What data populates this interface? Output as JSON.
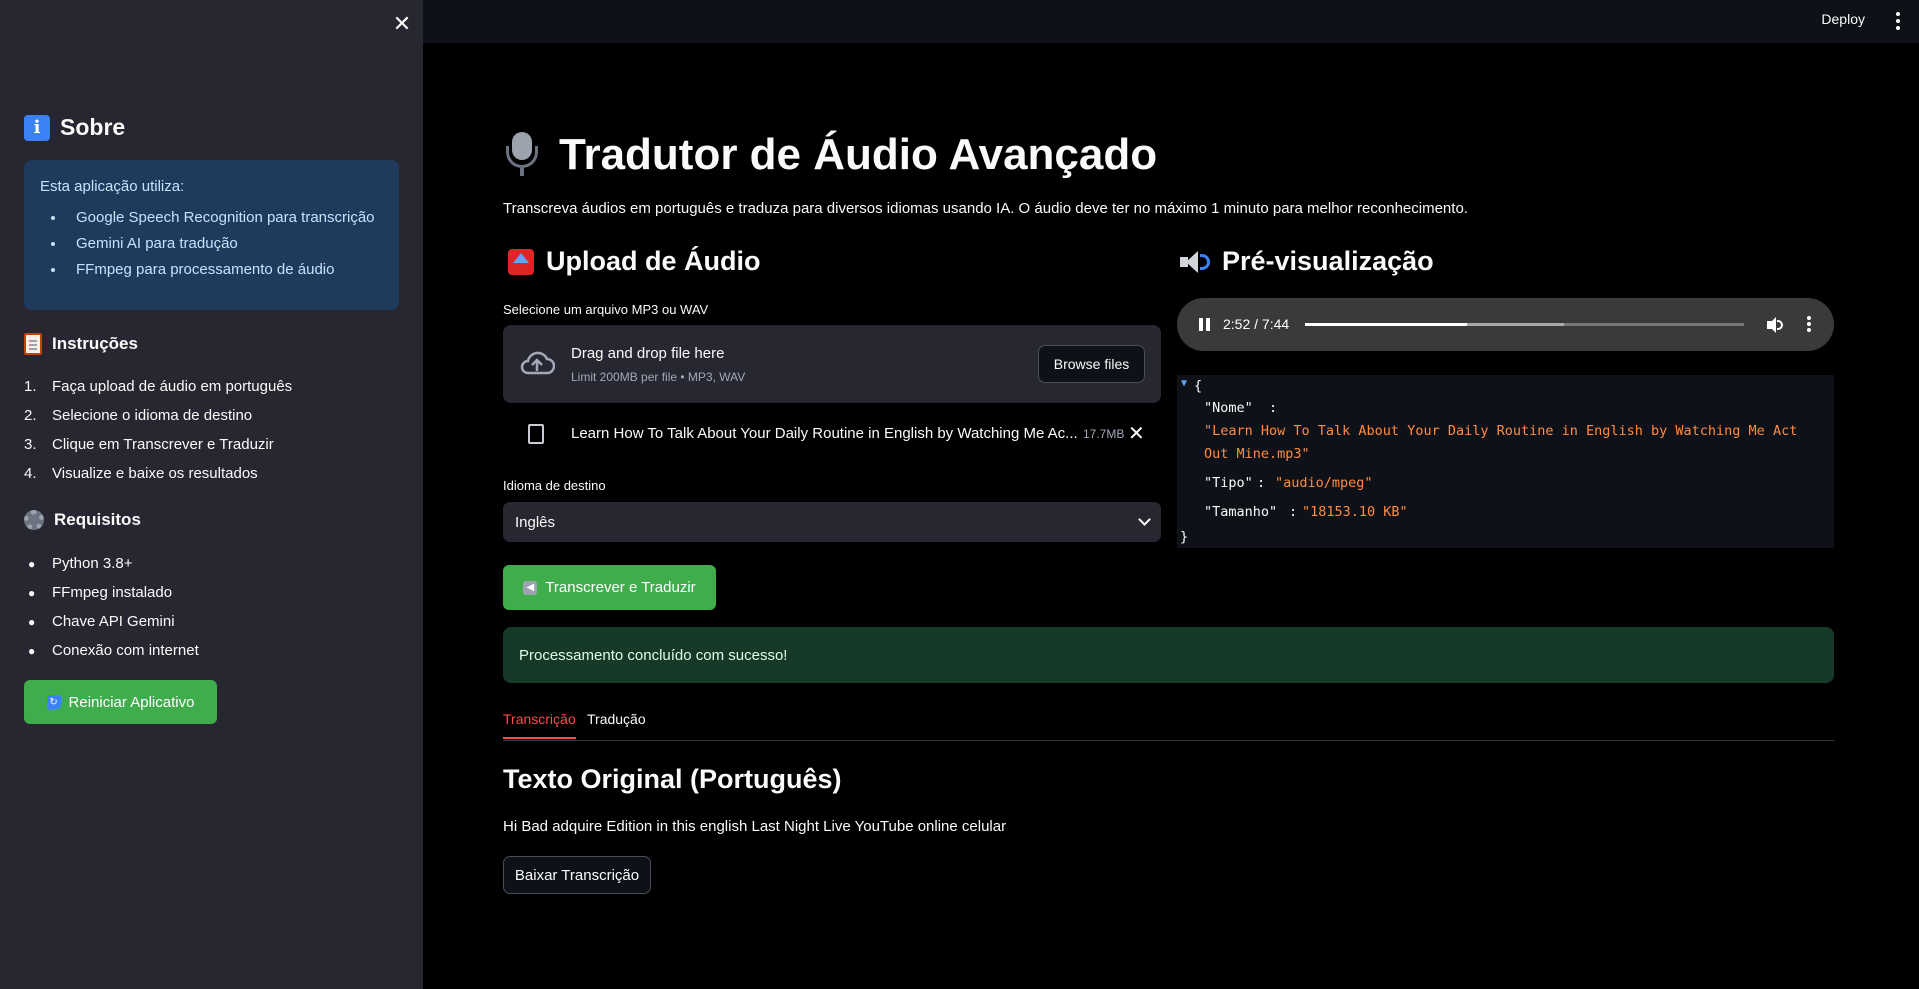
{
  "sidebar": {
    "sobre_title": "Sobre",
    "info": {
      "lead": "Esta aplicação utiliza:",
      "items": [
        "Google Speech Recognition para transcrição",
        "Gemini AI para tradução",
        "FFmpeg para processamento de áudio"
      ]
    },
    "instrucoes_title": "Instruções",
    "instrucoes": [
      {
        "n": "1.",
        "text": "Faça upload de áudio em português"
      },
      {
        "n": "2.",
        "text": "Selecione o idioma de destino"
      },
      {
        "n": "3.",
        "text": "Clique em Transcrever e Traduzir"
      },
      {
        "n": "4.",
        "text": "Visualize e baixe os resultados"
      }
    ],
    "requisitos_title": "Requisitos",
    "requisitos": [
      "Python 3.8+",
      "FFmpeg instalado",
      "Chave API Gemini",
      "Conexão com internet"
    ],
    "restart_label": "Reiniciar Aplicativo"
  },
  "topbar": {
    "deploy_label": "Deploy"
  },
  "main": {
    "title": "Tradutor de Áudio Avançado",
    "subtitle": "Transcreva áudios em português e traduza para diversos idiomas usando IA. O áudio deve ter no máximo 1 minuto para melhor reconhecimento.",
    "upload_title": "Upload de Áudio",
    "preview_title": "Pré-visualização",
    "file_label": "Selecione um arquivo MP3 ou WAV",
    "dropzone_title": "Drag and drop file here",
    "dropzone_sub": "Limit 200MB per file • MP3, WAV",
    "browse_label": "Browse files",
    "file_name": "Learn How To Talk About Your Daily Routine in English by Watching Me Ac...",
    "file_size": "17.7MB",
    "lang_label": "Idioma de destino",
    "lang_value": "Inglês",
    "action_label": "Transcrever e Traduzir",
    "audio": {
      "time": "2:52 / 7:44",
      "progress": 0.37,
      "buffered": 0.59
    },
    "json": {
      "open": "{",
      "close": "}",
      "k1": "\"Nome\"",
      "v1a": "\"Learn How To Talk About Your Daily Routine in English by Watching Me Act",
      "v1b": "Out Mine.mp3\"",
      "k2": "\"Tipo\"",
      "v2": "\"audio/mpeg\"",
      "k3": "\"Tamanho\"",
      "v3": "\"18153.10 KB\"",
      "sep": ":"
    },
    "success": "Processamento concluído com sucesso!",
    "tabs": [
      "Transcrição",
      "Tradução"
    ],
    "section_title": "Texto Original (Português)",
    "transcript": "Hi Bad adquire Edition in this english Last Night Live YouTube online celular",
    "download_label": "Baixar Transcrição"
  },
  "colors": {
    "accent": "#ff4b4b",
    "green": "#3fad4b",
    "info_bg": "#1e3a5c",
    "success_bg": "#173928"
  }
}
